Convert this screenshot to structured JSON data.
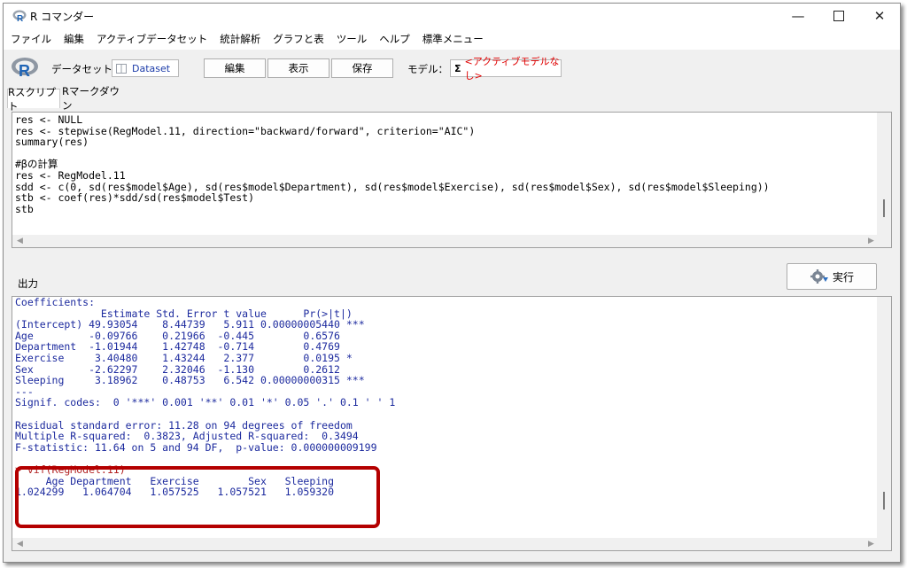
{
  "window": {
    "title": "R コマンダー"
  },
  "menu": [
    "ファイル",
    "編集",
    "アクティブデータセット",
    "統計解析",
    "グラフと表",
    "ツール",
    "ヘルプ",
    "標準メニュー"
  ],
  "toolbar": {
    "dataset_label": "データセット：",
    "dataset_value": "Dataset",
    "edit_label": "編集",
    "view_label": "表示",
    "save_label": "保存",
    "model_label": "モデル：",
    "model_value": "<アクティブモデルなし>"
  },
  "tabs": [
    "Rスクリプト",
    "Rマークダウン"
  ],
  "script_lines": [
    "res <- NULL",
    "res <- stepwise(RegModel.11, direction=\"backward/forward\", criterion=\"AIC\")",
    "summary(res)",
    "",
    "#βの計算",
    "res <- RegModel.11",
    "sdd <- c(0, sd(res$model$Age), sd(res$model$Department), sd(res$model$Exercise), sd(res$model$Sex), sd(res$model$Sleeping))",
    "stb <- coef(res)*sdd/sd(res$model$Test)",
    "stb"
  ],
  "output": {
    "label": "出力",
    "run_label": "実行",
    "lines": [
      "Coefficients:",
      "              Estimate Std. Error t value      Pr(>|t|)",
      "(Intercept) 49.93054    8.44739   5.911 0.00000005440 ***",
      "Age         -0.09766    0.21966  -0.445        0.6576",
      "Department  -1.01944    1.42748  -0.714        0.4769",
      "Exercise     3.40480    1.43244   2.377        0.0195 *",
      "Sex         -2.62297    2.32046  -1.130        0.2612",
      "Sleeping     3.18962    0.48753   6.542 0.00000000315 ***",
      "---",
      "Signif. codes:  0 '***' 0.001 '**' 0.01 '*' 0.05 '.' 0.1 ' ' 1",
      "",
      "Residual standard error: 11.28 on 94 degrees of freedom",
      "Multiple R-squared:  0.3823, Adjusted R-squared:  0.3494",
      "F-statistic: 11.64 on 5 and 94 DF,  p-value: 0.000000009199",
      ""
    ],
    "vif_command": "> vif(RegModel.11)",
    "vif_lines": [
      "     Age Department   Exercise        Sex   Sleeping",
      "1.024299   1.064704   1.057525   1.057521   1.059320"
    ]
  },
  "colors": {
    "highlight": "#b40000",
    "output_text": "#1c2a9e",
    "command_text": "#b22222"
  }
}
